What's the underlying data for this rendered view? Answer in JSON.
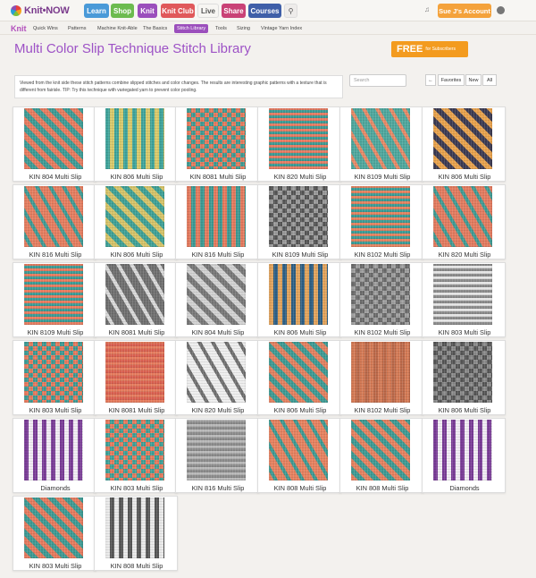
{
  "header": {
    "logo_text": "Knit•NOW",
    "nav": [
      {
        "label": "Learn",
        "color": "#4a9ad8"
      },
      {
        "label": "Shop",
        "color": "#6cbb4f"
      },
      {
        "label": "Knit",
        "color": "#9b4fbc"
      },
      {
        "label": "Knit Club",
        "color": "#e0585a"
      },
      {
        "label": "Live",
        "color": "#f3f1ee"
      },
      {
        "label": "Share",
        "color": "#c94276"
      },
      {
        "label": "Courses",
        "color": "#3f5fa8"
      }
    ],
    "account_label": "Sue J's Account"
  },
  "subnav": {
    "brand": "Knit",
    "items": [
      "Quick Wins",
      "Patterns",
      "Machine Knit-Able",
      "The Basics",
      "Stitch Library",
      "Tools",
      "Sizing",
      "Vintage Yarn Index"
    ],
    "active": "Stitch Library"
  },
  "page": {
    "title": "Multi Color Slip Technique Stitch Library",
    "promo_big": "FREE",
    "promo_small": "for Subscribers",
    "intro": "Viewed from the knit side these stitch patterns combine slipped stitches and color changes. The results are interesting graphic patterns with a texture that is different from fairisle. TIP: Try this technique with variegated yarn to prevent color pooling.",
    "search_placeholder": "Search",
    "filters": [
      "←",
      "Favorites",
      "New",
      "All"
    ]
  },
  "stitches": [
    "KIN 804 Multi Slip",
    "KIN 806 Multi Slip",
    "KIN 8081 Multi Slip",
    "KIN 820 Multi Slip",
    "KIN 8109 Multi Slip",
    "KIN 806 Multi Slip",
    "KIN 816 Multi Slip",
    "KIN 806 Multi Slip",
    "KIN 816 Multi Slip",
    "KIN 8109 Multi Slip",
    "KIN 8102 Multi Slip",
    "KIN 820 Multi Slip",
    "KIN 8109 Multi Slip",
    "KIN 8081 Multi Slip",
    "KIN 804 Multi Slip",
    "KIN 806 Multi Slip",
    "KIN 8102 Multi Slip",
    "KIN 803 Multi Slip",
    "KIN 803 Multi Slip",
    "KIN 8081 Multi Slip",
    "KIN 820 Multi Slip",
    "KIN 806 Multi Slip",
    "KIN 8102 Multi Slip",
    "KIN 806 Multi Slip",
    "Diamonds",
    "KIN 803 Multi Slip",
    "KIN 816 Multi Slip",
    "KIN 808 Multi Slip",
    "KIN 808 Multi Slip",
    "Diamonds",
    "KIN 803 Multi Slip",
    "KIN 808 Multi Slip"
  ],
  "swatch_palettes": [
    [
      "#e87b5e",
      "#3d9b95"
    ],
    [
      "#3fa49b",
      "#d9c96a"
    ],
    [
      "#e67a5c",
      "#3f9a92"
    ],
    [
      "#e57b62",
      "#3c9992"
    ],
    [
      "#4ea79d",
      "#e88966"
    ],
    [
      "#3b3a52",
      "#e8a24c"
    ],
    [
      "#e57d5f",
      "#3e9b95"
    ],
    [
      "#3ea096",
      "#d6c368"
    ],
    [
      "#e47a5d",
      "#3d9a93"
    ],
    [
      "#9a9a9a",
      "#555555"
    ],
    [
      "#e3825f",
      "#3c9a93"
    ],
    [
      "#e37b5f",
      "#3f9b94"
    ],
    [
      "#e67b5e",
      "#3c9a94"
    ],
    [
      "#6f6f6f",
      "#d9d9d9"
    ],
    [
      "#777777",
      "#d2d2d2"
    ],
    [
      "#e2a35b",
      "#2e5f84"
    ],
    [
      "#9f9f9f",
      "#6a6a6a"
    ],
    [
      "#8a8a8a",
      "#e4e4e4"
    ],
    [
      "#e67a5d",
      "#3d9a94"
    ],
    [
      "#e47a5c",
      "#d85f4f"
    ],
    [
      "#eeeeee",
      "#707070"
    ],
    [
      "#e3805f",
      "#3d9a93"
    ],
    [
      "#d47a55",
      "#bd6a4a"
    ],
    [
      "#8a8a8a",
      "#555555"
    ],
    [
      "#7a3c97",
      "#f1ecf4"
    ],
    [
      "#3ea097",
      "#e67a5d"
    ],
    [
      "#b7b7b7",
      "#8a8a8a"
    ],
    [
      "#e6815f",
      "#3d9a93"
    ],
    [
      "#e6815f",
      "#3d9a93"
    ],
    [
      "#7a3c97",
      "#f1ecf4"
    ],
    [
      "#e67a5d",
      "#3d9a93"
    ],
    [
      "#e9e9e9",
      "#575757"
    ]
  ]
}
